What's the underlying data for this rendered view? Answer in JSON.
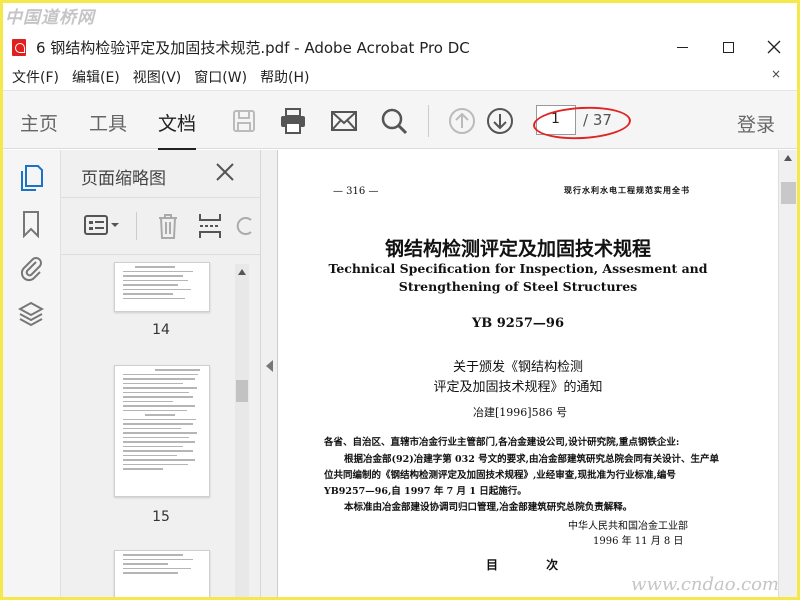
{
  "watermarks": {
    "top": "中国道桥网",
    "bottom": "www.cndao.com"
  },
  "window": {
    "title": "6 钢结构检验评定及加固技术规范.pdf - Adobe Acrobat Pro DC"
  },
  "menu": [
    "文件(F)",
    "编辑(E)",
    "视图(V)",
    "窗口(W)",
    "帮助(H)"
  ],
  "toolbar": {
    "tabs": [
      "主页",
      "工具",
      "文档"
    ],
    "active_tab": "文档",
    "page_current": "1",
    "page_total": "/ 37",
    "signin": "登录"
  },
  "thumbnails": {
    "title": "页面缩略图",
    "pages": [
      "14",
      "15"
    ]
  },
  "document": {
    "page_number": "— 316 —",
    "header": "现行水利水电工程规范实用全书",
    "title_cn": "钢结构检测评定及加固技术规程",
    "title_en_line1": "Technical Specification for Inspection, Assesment and",
    "title_en_line2": "Strengthening of Steel Structures",
    "code": "YB 9257—96",
    "notice_line1": "关于颁发《钢结构检测",
    "notice_line2": "评定及加固技术规程》的通知",
    "ref": "冶建[1996]586 号",
    "paragraphs": [
      "各省、自治区、直辖市冶金行业主管部门,各冶金建设公司,设计研究院,重点钢铁企业:",
      "根据冶金部(92)冶建字第 032 号文的要求,由冶金部建筑研究总院会同有关设计、生产单",
      "位共同编制的《钢结构检测评定及加固技术规程》,业经审查,现批准为行业标准,编号",
      "YB9257—96,自 1997 年 7 月 1 日起施行。",
      "本标准由冶金部建设协调司归口管理,冶金部建筑研究总院负责解释。"
    ],
    "signer": "中华人民共和国冶金工业部",
    "date": "1996 年 11 月 8 日",
    "contents": "目 次"
  },
  "colors": {
    "annotation_oval": "#e02424",
    "watermark": "#969696",
    "frame": "#f4e84a"
  }
}
